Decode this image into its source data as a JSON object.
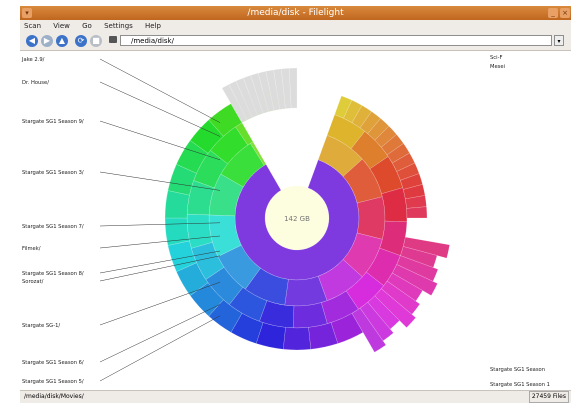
{
  "window": {
    "title": "/media/disk - Filelight"
  },
  "menu": {
    "scan": "Scan",
    "view": "View",
    "go": "Go",
    "settings": "Settings",
    "help": "Help"
  },
  "toolbar": {
    "address": "/media/disk/"
  },
  "chart": {
    "center_label": "142 GB",
    "left_labels": [
      "Jake 2.9/",
      "Dr. House/",
      "Stargate SG1 Season 9/",
      "Stargate SG1 Season 3/",
      "Stargate SG1 Season 7/",
      "Filmek/",
      "Stargate SG1 Season 8/",
      "Sorozat/",
      "Stargate SG-1/",
      "Stargate SG1 Season 6/",
      "Stargate SG1 Season 5/"
    ],
    "right_labels": [
      "Sci-F",
      "Mesei",
      "Stargate SG1 Season",
      "Stargate SG1 Season 1"
    ]
  },
  "status": {
    "path": "/media/disk/Movies/",
    "files": "27459 Files"
  },
  "colors": {
    "accent": "#c0661f",
    "chrome": "#efebe7"
  }
}
